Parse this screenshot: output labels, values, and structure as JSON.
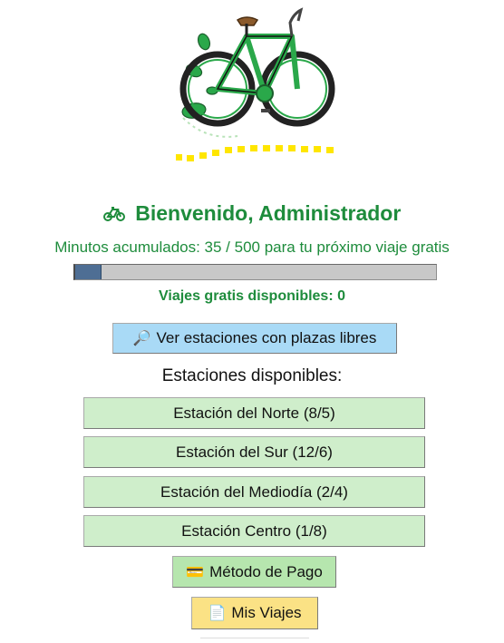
{
  "header": {
    "welcome_icon": "bicycle-icon",
    "welcome_text": "Bienvenido, Administrador"
  },
  "progress": {
    "text": "Minutos acumulados: 35 / 500 para tu próximo viaje gratis",
    "minutes": 35,
    "goal": 500,
    "fraction": 0.07
  },
  "free_trips": {
    "text": "Viajes gratis disponibles: 0"
  },
  "buttons": {
    "view_free": {
      "icon": "magnifier-icon",
      "label": "Ver estaciones con plazas libres"
    },
    "payment": {
      "icon": "credit-card-icon",
      "label": "Método de Pago"
    },
    "my_trips": {
      "icon": "document-icon",
      "label": "Mis Viajes"
    }
  },
  "stations": {
    "heading": "Estaciones disponibles:",
    "items": [
      {
        "label": "Estación del Norte (8/5)"
      },
      {
        "label": "Estación del Sur (12/6)"
      },
      {
        "label": "Estación del Mediodía (2/4)"
      },
      {
        "label": "Estación Centro (1/8)"
      }
    ]
  },
  "colors": {
    "brand_green": "#1e8c3c",
    "view_button": "#a9daf6",
    "station_button": "#cfeecb",
    "payment_button": "#b6e6ae",
    "trips_button": "#fbe285",
    "progress_fill": "#4e6e94"
  }
}
